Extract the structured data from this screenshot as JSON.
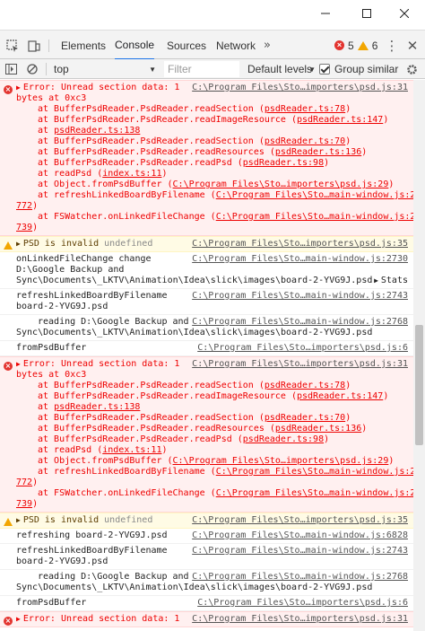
{
  "window": {
    "minimize_icon": "minimize-icon",
    "maximize_icon": "maximize-icon",
    "close_icon": "close-icon"
  },
  "tabs": {
    "items": [
      {
        "label": "Elements"
      },
      {
        "label": "Console"
      },
      {
        "label": "Sources"
      },
      {
        "label": "Network"
      }
    ],
    "overflow": "»",
    "error_count": "5",
    "warning_count": "6"
  },
  "toolbar": {
    "context": "top",
    "filter_placeholder": "Filter",
    "levels": "Default levels",
    "group_similar": "Group similar"
  },
  "messages": {
    "m1": {
      "line1": "Error: Unread section data: 1",
      "src1": "C:\\Program Files\\Sto…importers\\psd.js:31",
      "line2": "bytes at 0xc3",
      "s1a": "at BufferPsdReader.PsdReader.readSection (",
      "s1b": "psdReader.ts:78",
      "s2a": "at BufferPsdReader.PsdReader.readImageResource (",
      "s2b": "psdReader.ts:147",
      "s3a": "at ",
      "s3b": "psdReader.ts:138",
      "s4a": "at BufferPsdReader.PsdReader.readSection (",
      "s4b": "psdReader.ts:70",
      "s5a": "at BufferPsdReader.PsdReader.readResources (",
      "s5b": "psdReader.ts:136",
      "s6a": "at BufferPsdReader.PsdReader.readPsd (",
      "s6b": "psdReader.ts:98",
      "s7a": "at readPsd (",
      "s7b": "index.ts:11",
      "s8a": "at Object.fromPsdBuffer (",
      "s8b": "C:\\Program Files\\Sto…importers\\psd.js:29",
      "s9a": "at refreshLinkedBoardByFilename (",
      "s9b": "C:\\Program Files\\Sto…main-window.js:2",
      "s9c": "772",
      "s10a": "at FSWatcher.onLinkedFileChange (",
      "s10b": "C:\\Program Files\\Sto…main-window.js:2",
      "s10c": "739"
    },
    "m2": {
      "text": "PSD is invalid",
      "extra": "undefined",
      "src": "C:\\Program Files\\Sto…importers\\psd.js:35"
    },
    "m3": {
      "line1": "onLinkedFileChange change",
      "src": "C:\\Program Files\\Sto…main-window.js:2730",
      "line2": "D:\\Google Backup and",
      "line3": "Sync\\Documents\\_LKTV\\Animation\\Idea\\slick\\images\\board-2-YVG9J.psd",
      "stats": "Stats"
    },
    "m4": {
      "line1": "refreshLinkedBoardByFilename",
      "src": "C:\\Program Files\\Sto…main-window.js:2743",
      "line2": "board-2-YVG9J.psd"
    },
    "m5": {
      "line1": "reading D:\\Google Backup and",
      "src": "C:\\Program Files\\Sto…main-window.js:2768",
      "line2": "Sync\\Documents\\_LKTV\\Animation\\Idea\\slick\\images\\board-2-YVG9J.psd"
    },
    "m6": {
      "line1": "fromPsdBuffer",
      "src": "C:\\Program Files\\Sto…importers\\psd.js:6"
    },
    "m8": {
      "text": "PSD is invalid",
      "extra": "undefined",
      "src": "C:\\Program Files\\Sto…importers\\psd.js:35"
    },
    "m9": {
      "line1": "refreshing board-2-YVG9J.psd",
      "src": "C:\\Program Files\\Sto…main-window.js:6828"
    },
    "m10": {
      "line1": "refreshLinkedBoardByFilename",
      "src": "C:\\Program Files\\Sto…main-window.js:2743",
      "line2": "board-2-YVG9J.psd"
    },
    "m11": {
      "line1": "reading D:\\Google Backup and",
      "src": "C:\\Program Files\\Sto…main-window.js:2768",
      "line2": "Sync\\Documents\\_LKTV\\Animation\\Idea\\slick\\images\\board-2-YVG9J.psd"
    },
    "m12": {
      "line1": "fromPsdBuffer",
      "src": "C:\\Program Files\\Sto…importers\\psd.js:6"
    },
    "m13": {
      "line1": "Error: Unread section data: 1",
      "src": "C:\\Program Files\\Sto…importers\\psd.js:31"
    }
  }
}
